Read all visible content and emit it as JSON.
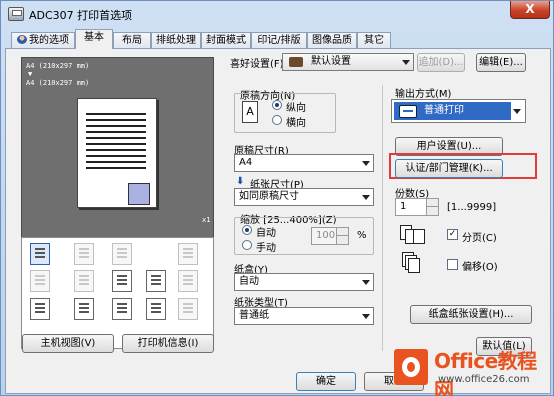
{
  "window": {
    "title": "ADC307 打印首选项",
    "close_label": "X"
  },
  "tabs": [
    {
      "label": "我的选项",
      "icon": "user-icon"
    },
    {
      "label": "基本"
    },
    {
      "label": "布局"
    },
    {
      "label": "排纸处理"
    },
    {
      "label": "封面模式"
    },
    {
      "label": "印记/排版"
    },
    {
      "label": "图像品质"
    },
    {
      "label": "其它"
    }
  ],
  "preview": {
    "line1": "A4  (210x297  mm)",
    "line2": "▼",
    "line3": "A4  (210x297  mm)",
    "scale": "x1"
  },
  "left_buttons": {
    "printer_view": "主机视图(V)",
    "printer_info": "打印机信息(I)"
  },
  "favorites": {
    "label": "喜好设置(F)",
    "value": "默认设置",
    "add_button": "追加(D)...",
    "edit_button": "编辑(E)..."
  },
  "orientation": {
    "label": "原稿方向(N)",
    "portrait": "纵向",
    "landscape": "横向",
    "selected": "portrait"
  },
  "original_size": {
    "label": "原稿尺寸(R)",
    "value": "A4"
  },
  "paper_size": {
    "label": "纸张尺寸(P)",
    "value": "如同原稿尺寸"
  },
  "zoom": {
    "label": "缩放 [25...400%](Z)",
    "auto": "自动",
    "manual": "手动",
    "value": "100",
    "unit": "%",
    "selected": "auto"
  },
  "tray": {
    "label": "纸盒(Y)",
    "value": "自动"
  },
  "paper_type": {
    "label": "纸张类型(T)",
    "value": "普通纸"
  },
  "output": {
    "label": "输出方式(M)",
    "value": "普通打印"
  },
  "user_settings_button": "用户设置(U)...",
  "auth_button": "认证/部门管理(K)...",
  "copies": {
    "label": "份数(S)",
    "value": "1",
    "range": "[1...9999]"
  },
  "collate": {
    "label": "分页(C)",
    "checked": true
  },
  "offset": {
    "label": "偏移(O)",
    "checked": false
  },
  "tray_settings_button": "纸盒纸张设置(H)...",
  "defaults_button": "默认值(L)",
  "dialog": {
    "ok": "确定",
    "cancel": "取消"
  },
  "watermark": {
    "title": "Office教程网",
    "url": "www.office26.com"
  },
  "colors": {
    "highlight": "#e03c3c",
    "output_accent": "#2f6ac4",
    "watermark": "#e8531f"
  }
}
